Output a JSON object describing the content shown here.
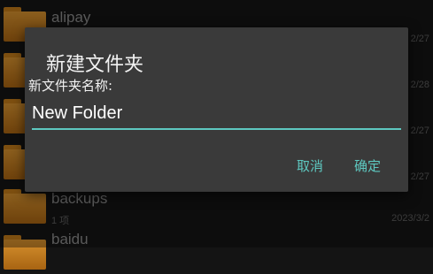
{
  "background_list": {
    "rows": [
      {
        "name": "alipay",
        "meta": "",
        "date": "2/27"
      },
      {
        "name": "",
        "meta": "",
        "date": "2/28"
      },
      {
        "name": "",
        "meta": "",
        "date": "2/27"
      },
      {
        "name": "",
        "meta": "",
        "date": "2/27"
      },
      {
        "name": "backups",
        "meta": "1 项",
        "date": "2023/3/2"
      },
      {
        "name": "baidu",
        "meta": "",
        "date": ""
      }
    ]
  },
  "dialog": {
    "title": "新建文件夹",
    "field_label": "新文件夹名称:",
    "input_value": "New Folder",
    "cancel_label": "取消",
    "ok_label": "确定"
  },
  "colors": {
    "accent": "#5ec8c0",
    "dialog_bg": "#3a3a3a",
    "folder": "#d6912e"
  }
}
